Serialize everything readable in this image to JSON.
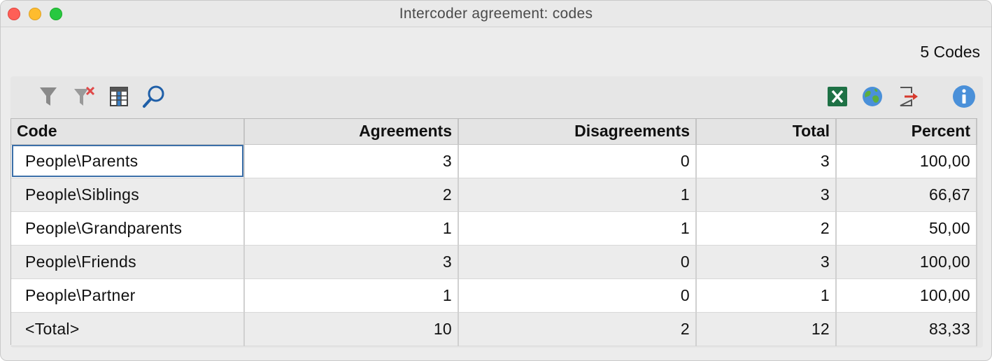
{
  "window": {
    "title": "Intercoder agreement: codes"
  },
  "summary": {
    "code_count": "5 Codes"
  },
  "toolbar": {
    "left": [
      {
        "name": "filter-icon"
      },
      {
        "name": "clear-filter-icon"
      },
      {
        "name": "columns-icon"
      },
      {
        "name": "search-icon"
      }
    ],
    "right": [
      {
        "name": "excel-export-icon"
      },
      {
        "name": "web-export-icon"
      },
      {
        "name": "export-icon"
      },
      {
        "name": "info-icon"
      }
    ]
  },
  "table": {
    "headers": [
      "Code",
      "Agreements",
      "Disagreements",
      "Total",
      "Percent"
    ],
    "rows": [
      [
        "People\\Parents",
        "3",
        "0",
        "3",
        "100,00"
      ],
      [
        "People\\Siblings",
        "2",
        "1",
        "3",
        "66,67"
      ],
      [
        "People\\Grandparents",
        "1",
        "1",
        "2",
        "50,00"
      ],
      [
        "People\\Friends",
        "3",
        "0",
        "3",
        "100,00"
      ],
      [
        "People\\Partner",
        "1",
        "0",
        "1",
        "100,00"
      ],
      [
        "<Total>",
        "10",
        "2",
        "12",
        "83,33"
      ]
    ]
  },
  "colors": {
    "excel": "#1e7145",
    "info": "#4a90d9",
    "search": "#1f5fa8",
    "selection": "#3b6fa8"
  }
}
